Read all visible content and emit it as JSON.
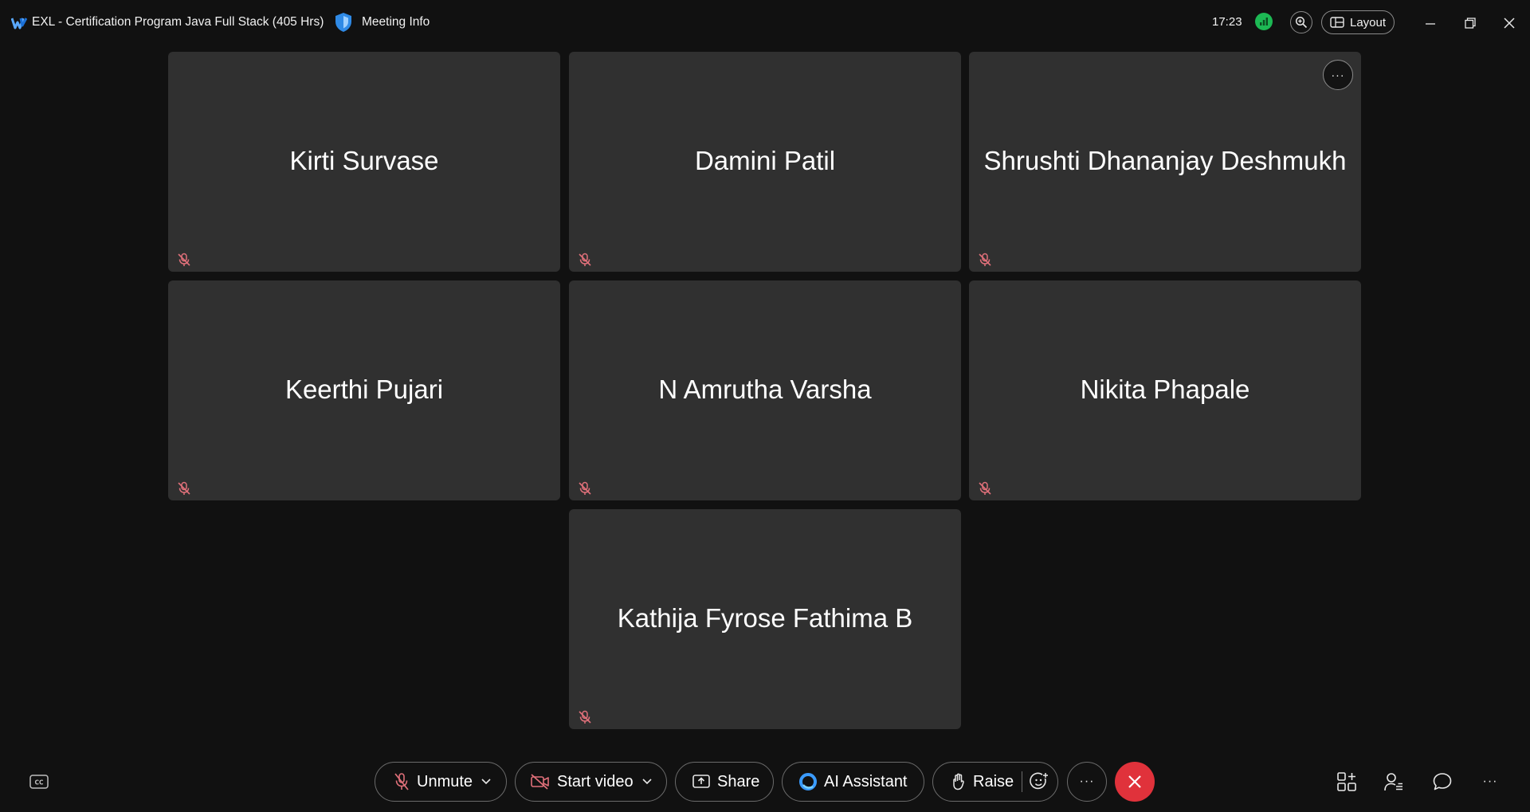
{
  "titlebar": {
    "meeting_title": "EXL - Certification Program Java Full Stack (405 Hrs)",
    "meeting_info": "Meeting Info",
    "clock": "17:23",
    "layout_label": "Layout"
  },
  "participants": [
    {
      "name": "Kirti Survase",
      "muted": true
    },
    {
      "name": "Damini Patil",
      "muted": true
    },
    {
      "name": "Shrushti Dhananjay Deshmukh",
      "muted": true
    },
    {
      "name": "Keerthi Pujari",
      "muted": true
    },
    {
      "name": "N Amrutha Varsha",
      "muted": true
    },
    {
      "name": "Nikita Phapale",
      "muted": true
    },
    {
      "name": "Kathija Fyrose Fathima B",
      "muted": true
    }
  ],
  "toolbar": {
    "unmute_label": "Unmute",
    "start_video_label": "Start video",
    "share_label": "Share",
    "ai_assistant_label": "AI Assistant",
    "raise_label": "Raise"
  },
  "colors": {
    "background": "#111111",
    "tile": "#303030",
    "muted_red": "#e0707a",
    "end_call_red": "#e0323b",
    "signal_green": "#1db954",
    "shield_blue": "#2f8ae6"
  },
  "icons": [
    "webex-logo-icon",
    "shield-icon",
    "signal-icon",
    "zoom-icon",
    "layout-grid-icon",
    "minimize-icon",
    "restore-icon",
    "close-icon",
    "microphone-muted-icon",
    "more-options-icon",
    "closed-caption-icon",
    "video-off-icon",
    "share-screen-icon",
    "ai-assistant-icon",
    "raise-hand-icon",
    "reactions-icon",
    "end-call-icon",
    "apps-icon",
    "participants-icon",
    "chat-icon"
  ]
}
